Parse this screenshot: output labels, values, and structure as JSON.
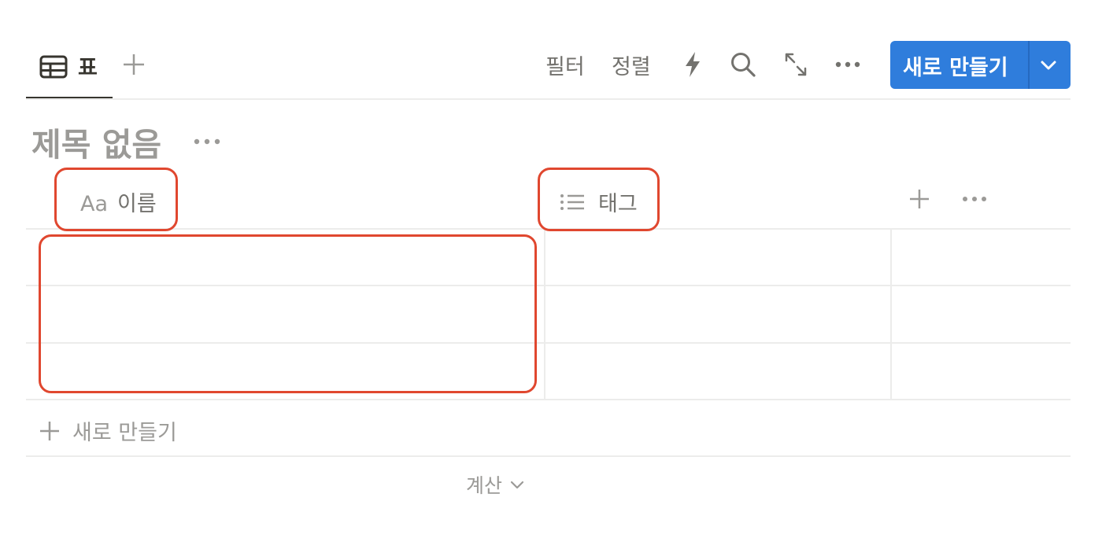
{
  "toolbar": {
    "view_tab_label": "표",
    "view_tab_icon": "table-icon",
    "add_view_icon": "plus-icon",
    "filter_label": "필터",
    "sort_label": "정렬",
    "automation_icon": "lightning-icon",
    "search_icon": "search-icon",
    "expand_icon": "expand-icon",
    "more_icon": "ellipsis-icon",
    "new_button_label": "새로 만들기",
    "new_button_dropdown_icon": "chevron-down-icon"
  },
  "database": {
    "title": "제목 없음",
    "title_more_icon": "ellipsis-icon"
  },
  "table": {
    "columns": [
      {
        "label": "이름",
        "type_icon_text": "Aa",
        "type_icon": "text-type-icon"
      },
      {
        "label": "태그",
        "type_icon": "list-icon"
      }
    ],
    "add_column_icon": "plus-icon",
    "column_more_icon": "ellipsis-icon",
    "rows": [
      {
        "name": "",
        "tags": ""
      },
      {
        "name": "",
        "tags": ""
      },
      {
        "name": "",
        "tags": ""
      }
    ],
    "new_row_label": "새로 만들기",
    "calculate_label": "계산"
  },
  "colors": {
    "accent": "#2f7ddc",
    "highlight": "#e0472f",
    "text_muted": "#9b9a97",
    "divider": "#ececeb"
  }
}
